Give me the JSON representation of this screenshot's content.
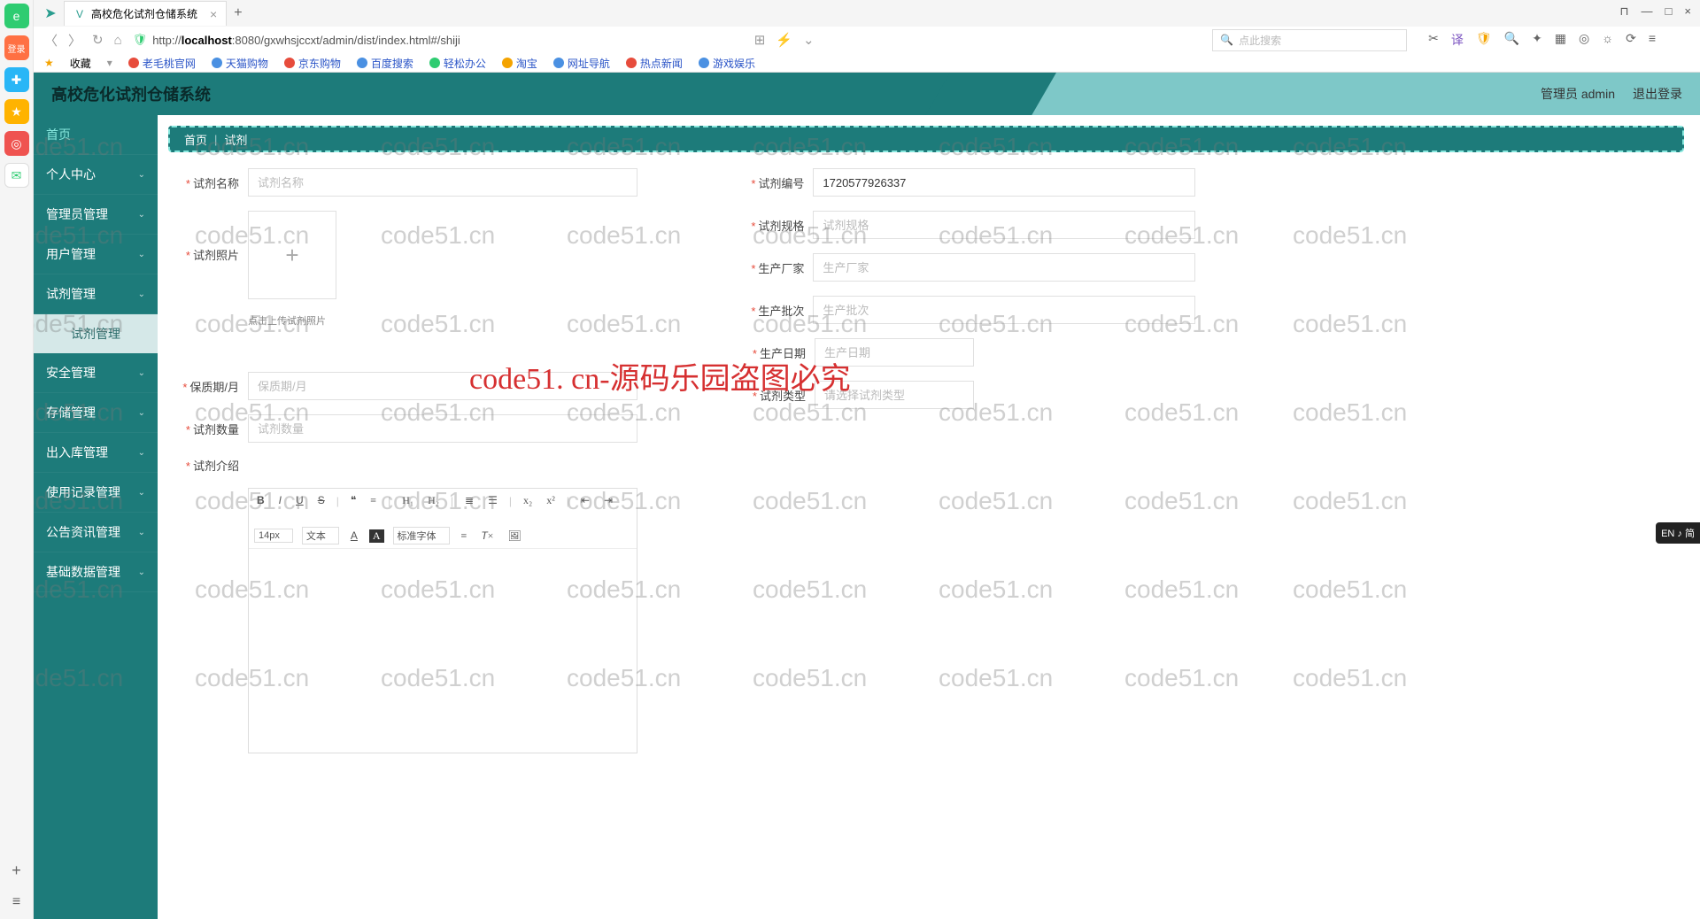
{
  "browser": {
    "tab_title": "高校危化试剂仓储系统",
    "url_prefix": "http://",
    "url_host": "localhost",
    "url_rest": ":8080/gxwhsjccxt/admin/dist/index.html#/shiji",
    "search_placeholder": "点此搜索",
    "fav_label": "收藏",
    "favorites": [
      "老毛桃官网",
      "天猫购物",
      "京东购物",
      "百度搜索",
      "轻松办公",
      "淘宝",
      "网址导航",
      "热点新闻",
      "游戏娱乐"
    ]
  },
  "header": {
    "app_title": "高校危化试剂仓储系统",
    "user": "管理员 admin",
    "logout": "退出登录"
  },
  "sidebar": {
    "home": "首页",
    "items": [
      "个人中心",
      "管理员管理",
      "用户管理",
      "试剂管理"
    ],
    "active_sub": "试剂管理",
    "items2": [
      "安全管理",
      "存储管理",
      "出入库管理",
      "使用记录管理",
      "公告资讯管理",
      "基础数据管理"
    ]
  },
  "breadcrumb": {
    "a": "首页",
    "b": "试剂"
  },
  "form": {
    "name_label": "试剂名称",
    "name_placeholder": "试剂名称",
    "photo_label": "试剂照片",
    "upload_hint": "点击上传试剂照片",
    "shelf_label": "保质期/月",
    "shelf_placeholder": "保质期/月",
    "qty_label": "试剂数量",
    "qty_placeholder": "试剂数量",
    "intro_label": "试剂介绍",
    "code_label": "试剂编号",
    "code_value": "1720577926337",
    "spec_label": "试剂规格",
    "spec_placeholder": "试剂规格",
    "mfr_label": "生产厂家",
    "mfr_placeholder": "生产厂家",
    "batch_label": "生产批次",
    "batch_placeholder": "生产批次",
    "date_label": "生产日期",
    "date_placeholder": "生产日期",
    "type_label": "试剂类型",
    "type_placeholder": "请选择试剂类型"
  },
  "editor": {
    "font_size": "14px",
    "block": "文本",
    "font_family": "标准字体"
  },
  "watermark": "code51.cn",
  "watermark_red": "code51. cn-源码乐园盗图必究",
  "ime": "EN ♪ 简"
}
